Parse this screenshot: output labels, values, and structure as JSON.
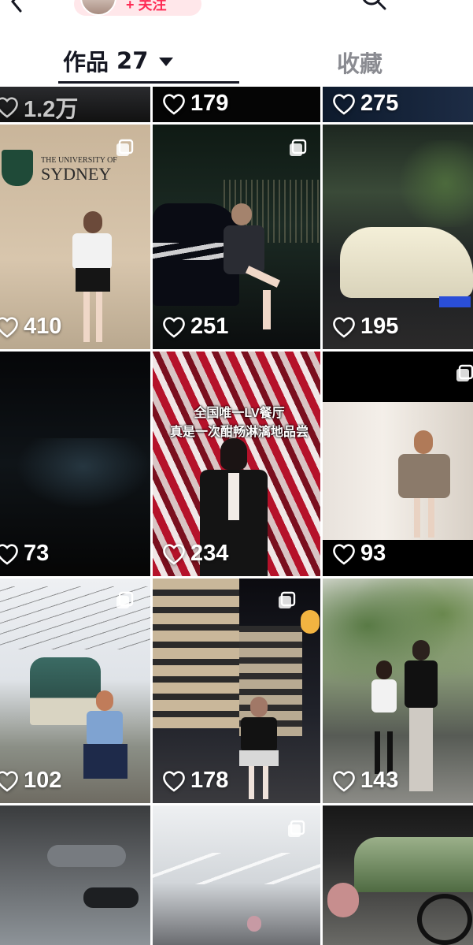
{
  "header": {
    "follow_label": "+ 关注",
    "icons": {
      "back": "chevron-left-icon",
      "search": "search-icon"
    }
  },
  "tabs": [
    {
      "label": "作品",
      "count": "27",
      "active": true
    },
    {
      "label": "收藏",
      "active": false
    }
  ],
  "grid": {
    "rows": [
      {
        "cells": [
          {
            "likes": "1.2万"
          },
          {
            "likes": "179"
          },
          {
            "likes": "275"
          }
        ]
      },
      {
        "cells": [
          {
            "likes": "410",
            "sign_line1": "THE UNIVERSITY OF",
            "sign_line2": "SYDNEY",
            "multi": true
          },
          {
            "likes": "251",
            "multi": true
          },
          {
            "likes": "195"
          }
        ]
      },
      {
        "cells": [
          {
            "likes": "73"
          },
          {
            "likes": "234",
            "caption_line1": "全国唯一LV餐厅",
            "caption_line2": "真是一次酣畅淋漓地品尝"
          },
          {
            "likes": "93",
            "multi": true
          }
        ]
      },
      {
        "cells": [
          {
            "likes": "102",
            "multi": true
          },
          {
            "likes": "178",
            "multi": true
          },
          {
            "likes": "143"
          }
        ]
      },
      {
        "cells": [
          {
            "likes": ""
          },
          {
            "likes": "",
            "multi": true
          },
          {
            "likes": ""
          }
        ]
      }
    ]
  },
  "colors": {
    "accent": "#fe2c55",
    "text": "#161823",
    "muted": "#8a8b91"
  }
}
